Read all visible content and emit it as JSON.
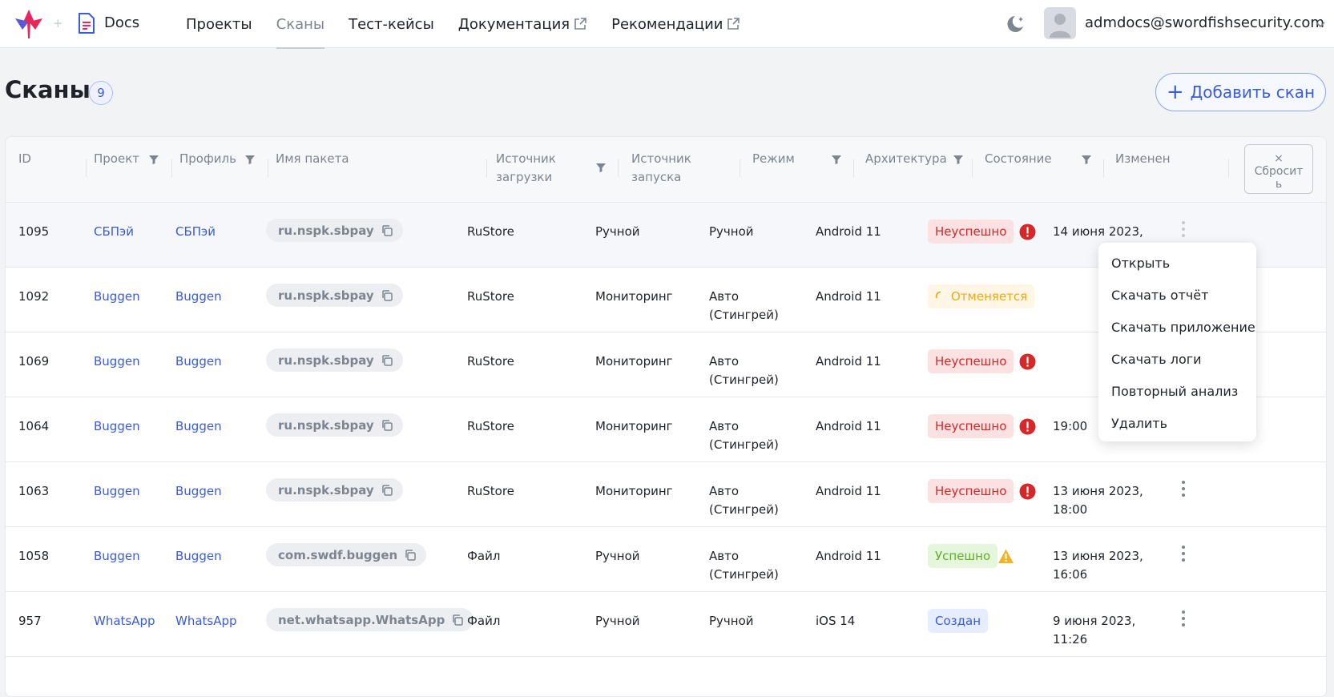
{
  "header": {
    "brand": "Docs",
    "nav": [
      {
        "label": "Проекты",
        "active": false,
        "external": false
      },
      {
        "label": "Сканы",
        "active": true,
        "external": false
      },
      {
        "label": "Тест-кейсы",
        "active": false,
        "external": false
      },
      {
        "label": "Документация",
        "active": false,
        "external": true
      },
      {
        "label": "Рекомендации",
        "active": false,
        "external": true
      }
    ],
    "user_email": "admdocs@swordfishsecurity.com"
  },
  "page": {
    "title": "Сканы",
    "count": "9",
    "add_button": "Добавить скан"
  },
  "table": {
    "columns": {
      "id": "ID",
      "project": "Проект",
      "profile": "Профиль",
      "package": "Имя пакета",
      "source_upload_1": "Источник",
      "source_upload_2": "загрузки",
      "source_launch_1": "Источник",
      "source_launch_2": "запуска",
      "mode": "Режим",
      "arch": "Архитектура",
      "state": "Состояние",
      "changed": "Изменен"
    },
    "reset_button_1": "Сбросит",
    "reset_button_2": "ь",
    "rows": [
      {
        "id": "1095",
        "project": "СБПэй",
        "profile": "СБПэй",
        "package": "ru.nspk.sbpay",
        "source_upload": "RuStore",
        "source_launch": "Ручной",
        "mode_1": "Ручной",
        "mode_2": "",
        "arch": "Android 11",
        "state": "Неуспешно",
        "state_type": "fail",
        "changed_1": "14 июня 2023,",
        "changed_2": ""
      },
      {
        "id": "1092",
        "project": "Buggen",
        "profile": "Buggen",
        "package": "ru.nspk.sbpay",
        "source_upload": "RuStore",
        "source_launch": "Мониторинг",
        "mode_1": "Авто",
        "mode_2": "(Стингрей)",
        "arch": "Android 11",
        "state": "Отменяется",
        "state_type": "cancel",
        "changed_1": "",
        "changed_2": ""
      },
      {
        "id": "1069",
        "project": "Buggen",
        "profile": "Buggen",
        "package": "ru.nspk.sbpay",
        "source_upload": "RuStore",
        "source_launch": "Мониторинг",
        "mode_1": "Авто",
        "mode_2": "(Стингрей)",
        "arch": "Android 11",
        "state": "Неуспешно",
        "state_type": "fail",
        "changed_1": "",
        "changed_2": ""
      },
      {
        "id": "1064",
        "project": "Buggen",
        "profile": "Buggen",
        "package": "ru.nspk.sbpay",
        "source_upload": "RuStore",
        "source_launch": "Мониторинг",
        "mode_1": "Авто",
        "mode_2": "(Стингрей)",
        "arch": "Android 11",
        "state": "Неуспешно",
        "state_type": "fail",
        "changed_1": "",
        "changed_2": "19:00"
      },
      {
        "id": "1063",
        "project": "Buggen",
        "profile": "Buggen",
        "package": "ru.nspk.sbpay",
        "source_upload": "RuStore",
        "source_launch": "Мониторинг",
        "mode_1": "Авто",
        "mode_2": "(Стингрей)",
        "arch": "Android 11",
        "state": "Неуспешно",
        "state_type": "fail",
        "changed_1": "13 июня 2023,",
        "changed_2": "18:00"
      },
      {
        "id": "1058",
        "project": "Buggen",
        "profile": "Buggen",
        "package": "com.swdf.buggen",
        "source_upload": "Файл",
        "source_launch": "Ручной",
        "mode_1": "Авто",
        "mode_2": "(Стингрей)",
        "arch": "Android 11",
        "state": "Успешно",
        "state_type": "ok",
        "changed_1": "13 июня 2023,",
        "changed_2": "16:06"
      },
      {
        "id": "957",
        "project": "WhatsApp",
        "profile": "WhatsApp",
        "package": "net.whatsapp.WhatsApp",
        "source_upload": "Файл",
        "source_launch": "Ручной",
        "mode_1": "Ручной",
        "mode_2": "",
        "arch": "iOS 14",
        "state": "Создан",
        "state_type": "new",
        "changed_1": "9 июня 2023,",
        "changed_2": "11:26"
      }
    ]
  },
  "context_menu": {
    "items": [
      "Открыть",
      "Скачать отчёт",
      "Скачать приложение",
      "Скачать логи",
      "Повторный анализ",
      "Удалить"
    ]
  },
  "colors": {
    "accent": "#3a5bd9",
    "fail": "#d62828",
    "cancel": "#f0a818",
    "success": "#5fae2a"
  }
}
